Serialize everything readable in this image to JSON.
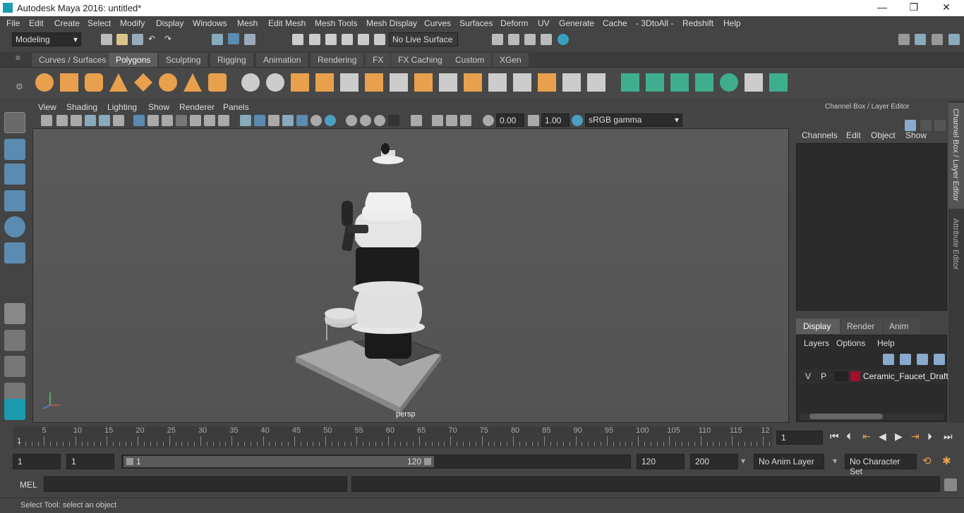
{
  "window": {
    "title": "Autodesk Maya 2016: untitled*",
    "min": "—",
    "max": "❐",
    "close": "✕"
  },
  "menus": [
    "File",
    "Edit",
    "Create",
    "Select",
    "Modify",
    "Display",
    "Windows",
    "Mesh",
    "Edit Mesh",
    "Mesh Tools",
    "Mesh Display",
    "Curves",
    "Surfaces",
    "Deform",
    "UV",
    "Generate",
    "Cache",
    "- 3DtoAll -",
    "Redshift",
    "Help"
  ],
  "toolbar": {
    "mode": "Modeling",
    "live_surface": "No Live Surface"
  },
  "shelf_tabs": [
    "Curves / Surfaces",
    "Polygons",
    "Sculpting",
    "Rigging",
    "Animation",
    "Rendering",
    "FX",
    "FX Caching",
    "Custom",
    "XGen"
  ],
  "shelf_active": "Polygons",
  "viewport": {
    "menus": [
      "View",
      "Shading",
      "Lighting",
      "Show",
      "Renderer",
      "Panels"
    ],
    "exposure": "0.00",
    "gamma": "1.00",
    "colorspace": "sRGB gamma",
    "camera": "persp"
  },
  "channel_box": {
    "title": "Channel Box / Layer Editor",
    "menus": [
      "Channels",
      "Edit",
      "Object",
      "Show"
    ],
    "tabs": [
      "Display",
      "Render",
      "Anim"
    ],
    "layer_menus": [
      "Layers",
      "Options",
      "Help"
    ],
    "layer": {
      "v": "V",
      "p": "P",
      "name": "Ceramic_Faucet_Draft_",
      "color": "#a0102c"
    }
  },
  "side_tabs": [
    "Channel Box / Layer Editor",
    "Attribute Editor"
  ],
  "timeline": {
    "labels": [
      "5",
      "10",
      "15",
      "20",
      "25",
      "30",
      "35",
      "40",
      "45",
      "50",
      "55",
      "60",
      "65",
      "70",
      "75",
      "80",
      "85",
      "90",
      "95",
      "100",
      "105",
      "110",
      "115",
      "12"
    ],
    "start_label": "1",
    "current": "1"
  },
  "range": {
    "start": "1",
    "anim_start": "1",
    "slider_start": "1",
    "slider_end": "120",
    "end": "120",
    "anim_end": "200",
    "anim_layer": "No Anim Layer",
    "char_set": "No Character Set"
  },
  "command": {
    "lang": "MEL"
  },
  "status": "Select Tool: select an object",
  "colors": {
    "accent": "#1b9bb0",
    "shelf_orange": "#e8a04c",
    "shelf_green": "#3fae8e"
  }
}
